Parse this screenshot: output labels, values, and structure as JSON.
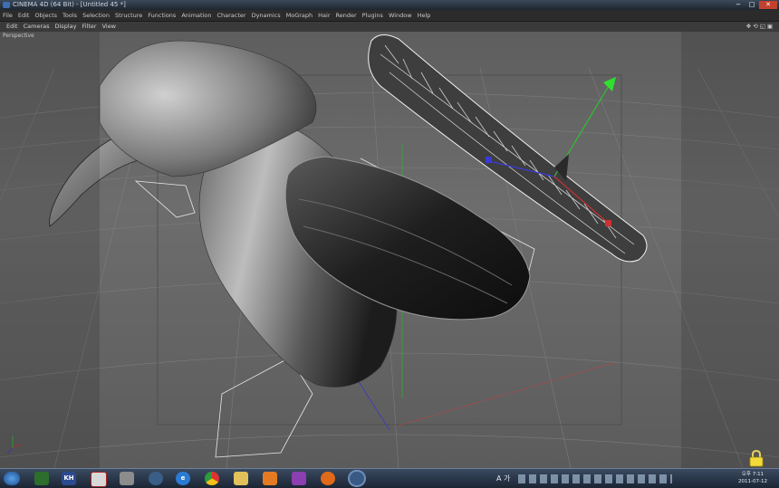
{
  "window": {
    "title": "CINEMA 4D (64 Bit) - [Untitled 45 *]",
    "controls": [
      "−",
      "□",
      "✕"
    ]
  },
  "menubar": {
    "items": [
      "File",
      "Edit",
      "Objects",
      "Tools",
      "Selection",
      "Structure",
      "Functions",
      "Animation",
      "Character",
      "Dynamics",
      "MoGraph",
      "Hair",
      "Render",
      "Plugins",
      "Window",
      "Help"
    ]
  },
  "viewport_menu": {
    "items": [
      "Edit",
      "Cameras",
      "Display",
      "Filter",
      "View"
    ],
    "nav_icons": [
      "✥",
      "⟲",
      "◱",
      "▣"
    ]
  },
  "viewport": {
    "label": "Perspective"
  },
  "taskbar": {
    "start": "start-orb-icon",
    "apps": [
      {
        "icon": "app-icon",
        "label": ""
      },
      {
        "icon": "kh-icon",
        "label": "KH"
      },
      {
        "icon": "media-icon",
        "label": ""
      },
      {
        "icon": "document-icon",
        "label": ""
      },
      {
        "icon": "cinema4d-icon",
        "label": ""
      },
      {
        "icon": "ie-icon",
        "label": "e"
      },
      {
        "icon": "chrome-icon",
        "label": ""
      },
      {
        "icon": "folder-icon",
        "label": ""
      },
      {
        "icon": "player-icon",
        "label": ""
      },
      {
        "icon": "edit-icon",
        "label": ""
      },
      {
        "icon": "firefox-icon",
        "label": ""
      },
      {
        "icon": "c4d-active-icon",
        "label": ""
      }
    ],
    "tray_text": "A 가",
    "clock_time": "오후 7:11",
    "clock_date": "2011-07-12"
  },
  "colors": {
    "taskbar": "#1f2a3a",
    "viewport_bg": "#666666",
    "axis_x": "#c83232",
    "axis_y": "#28c828",
    "axis_z": "#3232c8"
  }
}
